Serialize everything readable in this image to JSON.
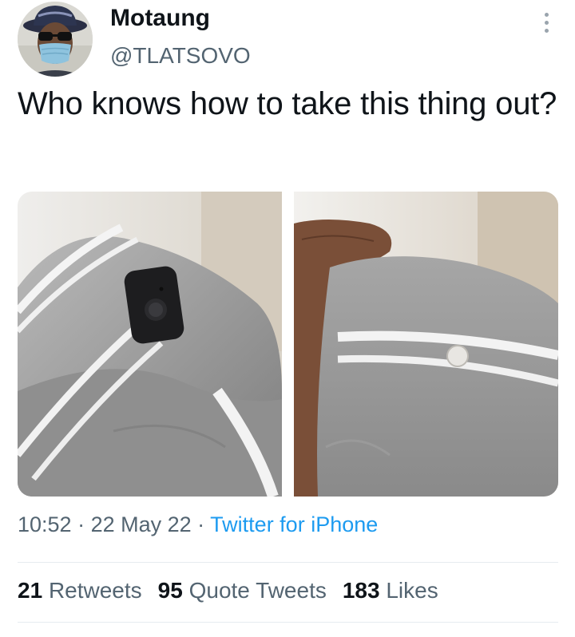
{
  "author": {
    "name": "Motaung",
    "handle": "@TLATSOVO"
  },
  "tweet": {
    "text": "Who knows how to take this thing out?",
    "time": "10:52",
    "separator": " · ",
    "date": "22 May 22",
    "source": "Twitter for iPhone"
  },
  "stats": {
    "retweets_count": "21",
    "retweets_label": "Retweets",
    "quotes_count": "95",
    "quotes_label": "Quote Tweets",
    "likes_count": "183",
    "likes_label": "Likes"
  },
  "icons": {
    "more": "more-vertical-icon"
  },
  "colors": {
    "text_primary": "#0f1419",
    "text_secondary": "#536471",
    "link": "#1d9bf0",
    "divider": "#e6ecf0"
  }
}
